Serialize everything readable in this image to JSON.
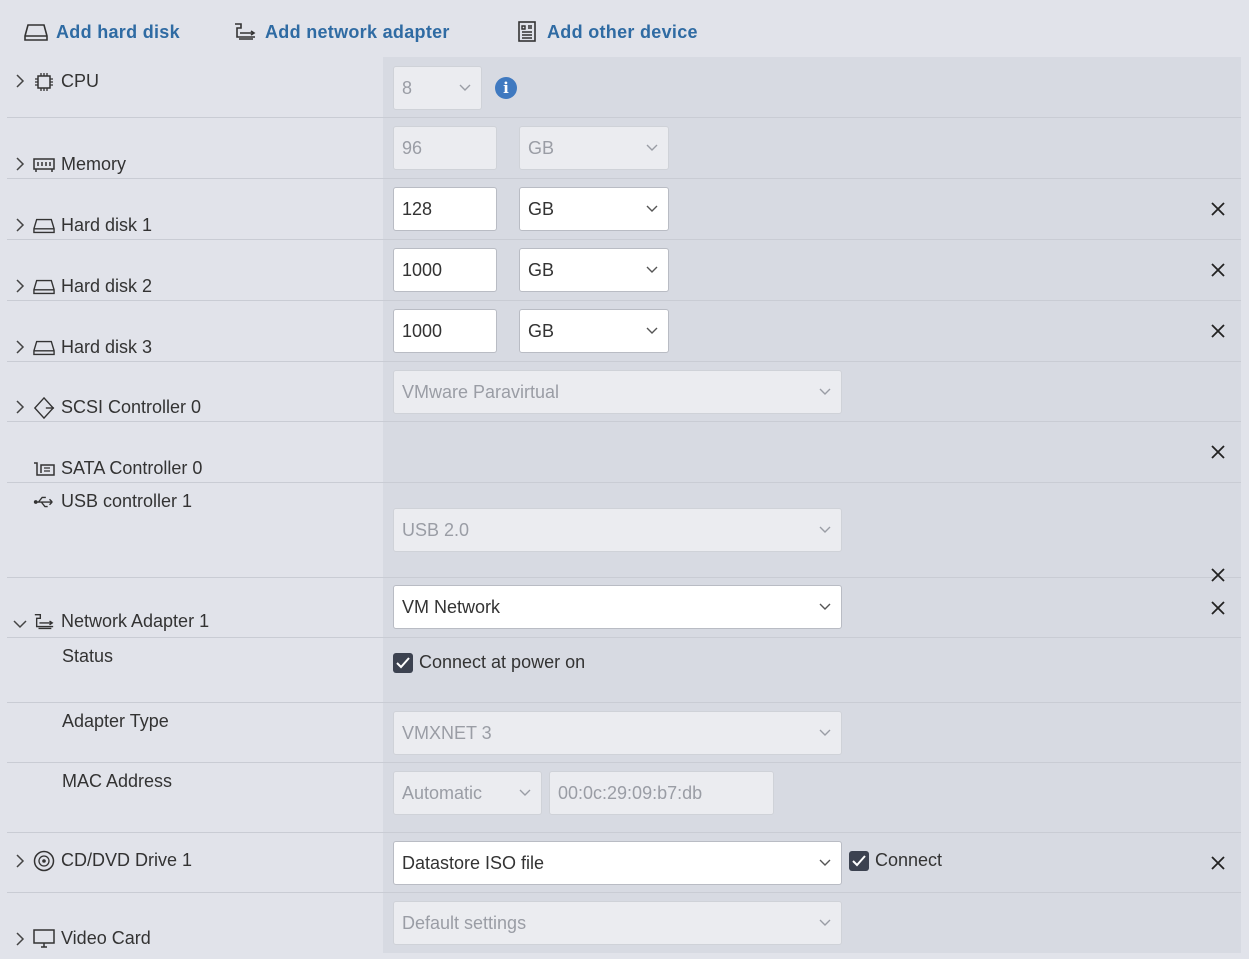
{
  "toolbar": {
    "add_hard_disk": "Add hard disk",
    "add_network_adapter": "Add network adapter",
    "add_other_device": "Add other device"
  },
  "devices": {
    "cpu": {
      "label": "CPU",
      "value": "8"
    },
    "memory": {
      "label": "Memory",
      "value": "96",
      "unit": "GB"
    },
    "hard_disk_1": {
      "label": "Hard disk 1",
      "value": "128",
      "unit": "GB"
    },
    "hard_disk_2": {
      "label": "Hard disk 2",
      "value": "1000",
      "unit": "GB"
    },
    "hard_disk_3": {
      "label": "Hard disk 3",
      "value": "1000",
      "unit": "GB"
    },
    "scsi": {
      "label": "SCSI Controller 0",
      "value": "VMware Paravirtual"
    },
    "sata": {
      "label": "SATA Controller 0"
    },
    "usb": {
      "label": "USB controller 1",
      "value": "USB 2.0"
    },
    "network": {
      "label": "Network Adapter 1",
      "value": "VM Network",
      "status_label": "Status",
      "connect_at_power_on": "Connect at power on",
      "adapter_type_label": "Adapter Type",
      "adapter_type": "VMXNET 3",
      "mac_label": "MAC Address",
      "mac_mode": "Automatic",
      "mac_value": "00:0c:29:09:b7:db"
    },
    "cddvd": {
      "label": "CD/DVD Drive 1",
      "value": "Datastore ISO file",
      "connect": "Connect"
    },
    "video": {
      "label": "Video Card",
      "value": "Default settings"
    }
  },
  "colors": {
    "accent": "#2f6ba3",
    "info": "#3f79c0",
    "background": "#e1e3ea"
  },
  "icons": [
    "hard-disk-icon",
    "network-adapter-icon",
    "other-device-icon",
    "cpu-icon",
    "memory-icon",
    "scsi-icon",
    "sata-icon",
    "usb-icon",
    "cd-dvd-icon",
    "monitor-icon",
    "info-icon",
    "close-icon",
    "chevron-right-icon",
    "chevron-down-icon",
    "checkbox-checked-icon"
  ]
}
